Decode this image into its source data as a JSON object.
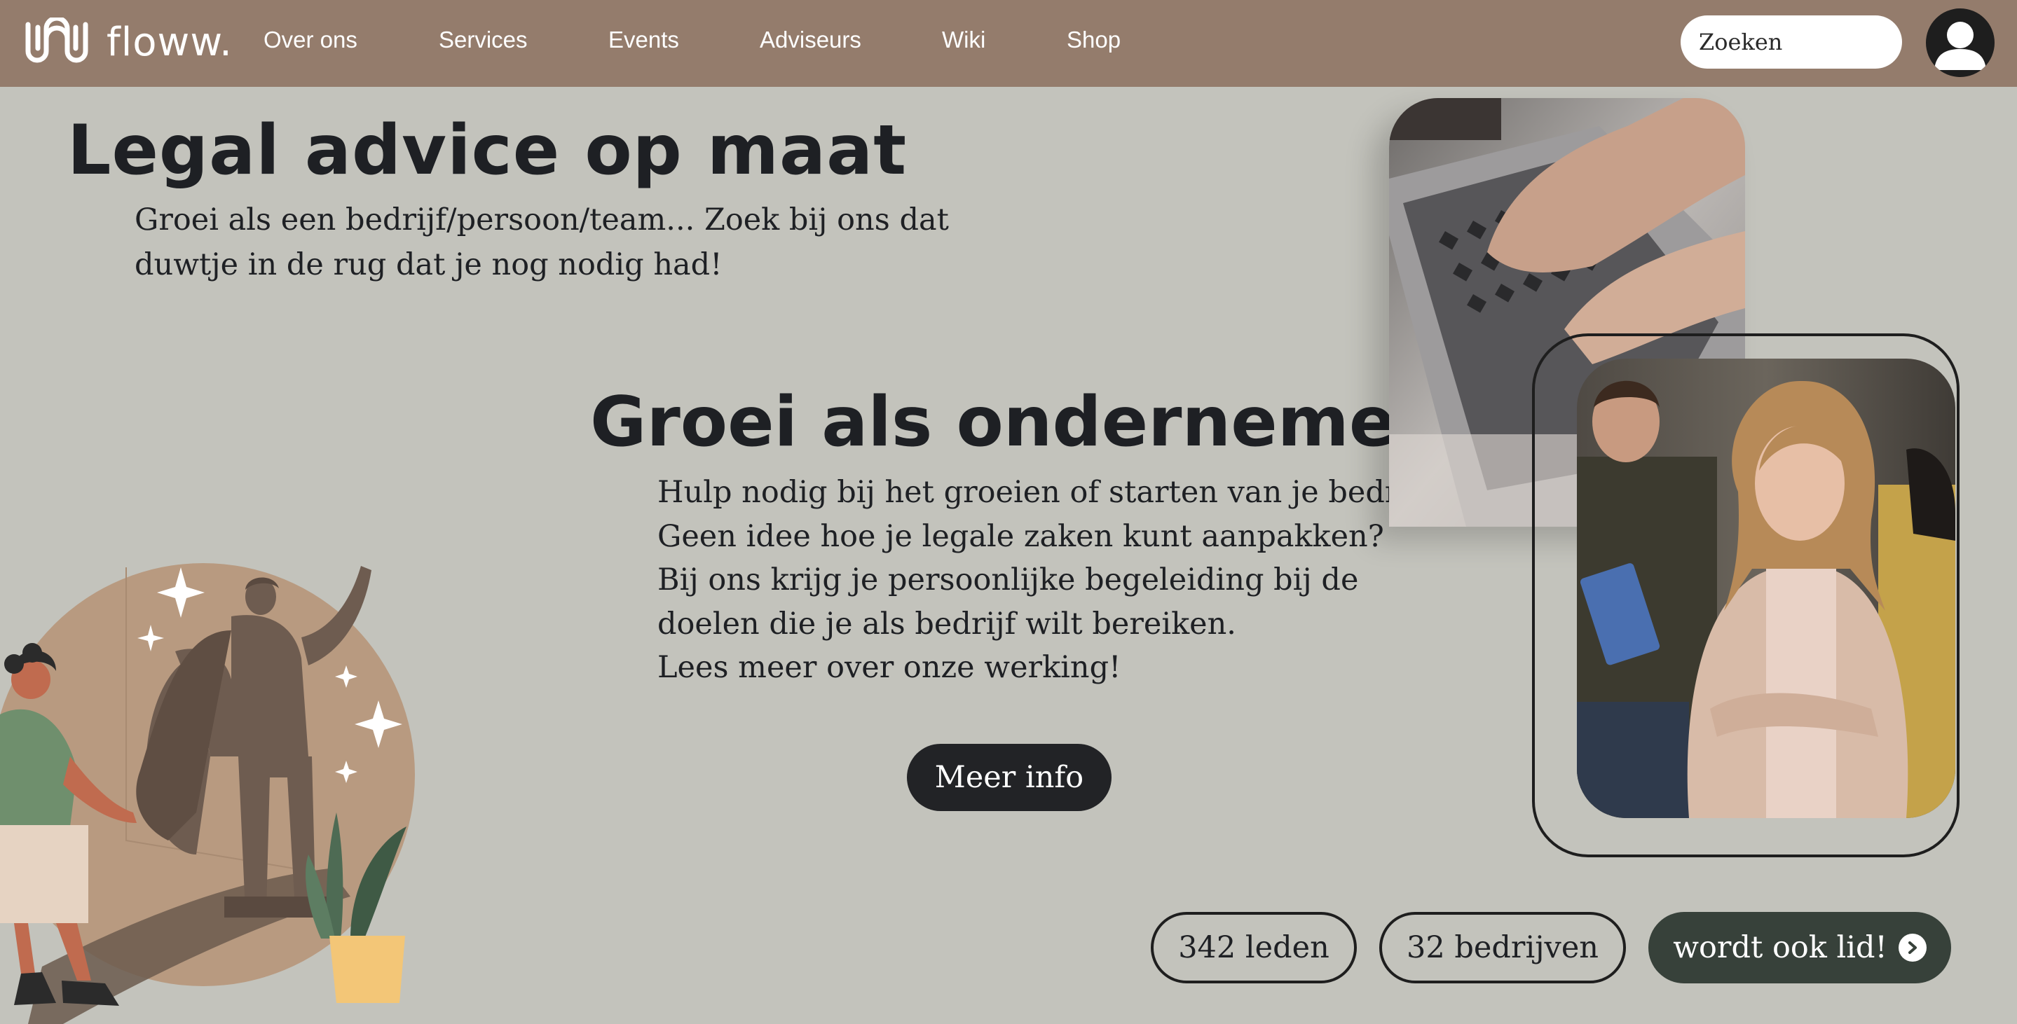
{
  "nav": {
    "brand": "floww.",
    "links": [
      "Over ons",
      "Services",
      "Events",
      "Adviseurs",
      "Wiki",
      "Shop"
    ],
    "search_placeholder": "Zoeken"
  },
  "hero": {
    "title": "Legal advice op maat",
    "subtitle": "Groei als een bedrijf/persoon/team... Zoek bij ons dat duwtje in de rug dat je nog nodig had!"
  },
  "section": {
    "title": "Groei als ondernemer",
    "lines": [
      "Hulp nodig bij het groeien of starten van je bedrijf?",
      "Geen idee hoe je legale zaken kunt aanpakken?",
      "Bij ons krijg je persoonlijke begeleiding bij de",
      "doelen die je als bedrijf wilt bereiken.",
      "Lees meer over onze werking!"
    ],
    "cta": "Meer info"
  },
  "stats": {
    "members": "342 leden",
    "companies": "32 bedrijven",
    "join": "wordt ook lid!"
  },
  "colors": {
    "background": "#c3c3bc",
    "navbar": "#947c6c",
    "dark_button": "#222326",
    "join_button": "#37413a",
    "text": "#1e2024"
  },
  "icons": {
    "logo": "floww-wave-logo-icon",
    "avatar": "user-avatar-icon",
    "join_arrow": "chevron-right-circle-icon"
  }
}
